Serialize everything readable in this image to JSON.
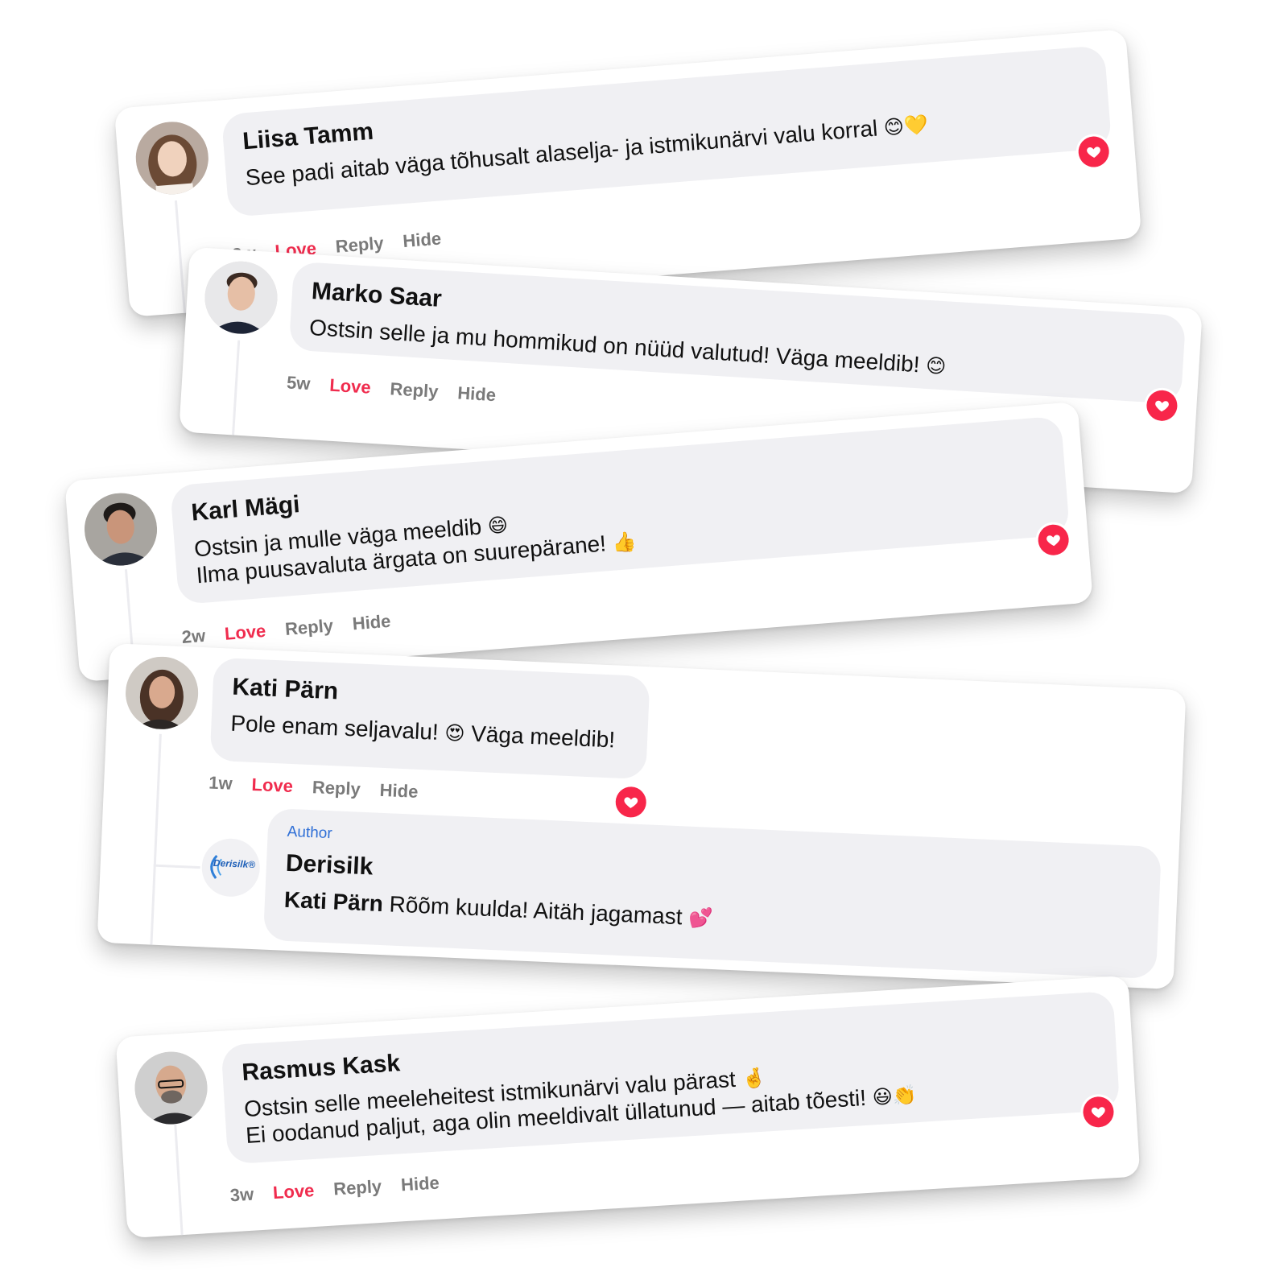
{
  "colors": {
    "love": "#f02c4e",
    "heart_badge": "#f8264a",
    "bubble_bg": "#f0f0f3",
    "meta_text": "#7a7a7a",
    "author_tag": "#2f6fd6",
    "brand": "#1d5fb8"
  },
  "comments": [
    {
      "name": "Liisa Tamm",
      "text_lines": [
        "See padi aitab väga tõhusalt alaselja- ja istmikunärvi valu korral"
      ],
      "emoji": "😊💛",
      "time": "2w",
      "love": "Love",
      "reply": "Reply",
      "hide": "Hide",
      "avatar_icon": "woman-avatar-icon",
      "reaction_icon": "heart-icon"
    },
    {
      "name": "Marko Saar",
      "text_lines": [
        "Ostsin selle ja mu hommikud on nüüd valutud! Väga meeldib!"
      ],
      "emoji": "😊",
      "time": "5w",
      "love": "Love",
      "reply": "Reply",
      "hide": "Hide",
      "avatar_icon": "man-avatar-icon",
      "reaction_icon": "heart-icon"
    },
    {
      "name": "Karl Mägi",
      "text_lines": [
        "Ostsin ja mulle väga meeldib",
        "Ilma puusavaluta ärgata on suurepärane!"
      ],
      "emoji_line1": "😄",
      "emoji_line2": "👍",
      "time": "2w",
      "love": "Love",
      "reply": "Reply",
      "hide": "Hide",
      "avatar_icon": "man-avatar-icon",
      "reaction_icon": "heart-icon"
    },
    {
      "name": "Kati Pärn",
      "text_part1": "Pole enam seljavalu!",
      "emoji": "😍",
      "text_part2": "Väga meeldib!",
      "time": "1w",
      "love": "Love",
      "reply": "Reply",
      "hide": "Hide",
      "avatar_icon": "woman-avatar-icon",
      "reaction_icon": "heart-icon",
      "reply_comment": {
        "author_tag": "Author",
        "name": "Derisilk",
        "brand_logo_text": "Derisilk®",
        "mention": "Kati Pärn",
        "text": "Rõõm kuulda! Aitäh jagamast",
        "emoji": "💕"
      }
    },
    {
      "name": "Rasmus Kask",
      "text_lines": [
        "Ostsin selle meeleheitest istmikunärvi valu pärast",
        "Ei oodanud paljut, aga olin meeldivalt üllatunud — aitab tõesti!"
      ],
      "emoji_line1": "🤞",
      "emoji_line2": "😃👏",
      "time": "3w",
      "love": "Love",
      "reply": "Reply",
      "hide": "Hide",
      "avatar_icon": "man-avatar-icon",
      "reaction_icon": "heart-icon"
    }
  ]
}
